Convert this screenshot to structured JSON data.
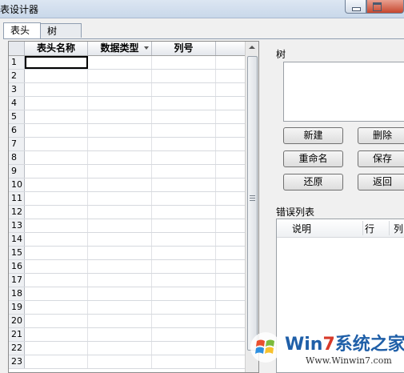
{
  "window": {
    "title": "表设计器"
  },
  "tabs": [
    {
      "label": "表头"
    },
    {
      "label": "树"
    }
  ],
  "grid": {
    "columns": [
      {
        "label": "表头名称"
      },
      {
        "label": "数据类型"
      },
      {
        "label": "列号"
      },
      {
        "label": ""
      }
    ],
    "rows": [
      "1",
      "2",
      "3",
      "4",
      "5",
      "6",
      "7",
      "8",
      "9",
      "10",
      "11",
      "12",
      "13",
      "14",
      "15",
      "16",
      "17",
      "18",
      "19",
      "20",
      "21",
      "22",
      "23"
    ]
  },
  "tree_panel": {
    "label": "树"
  },
  "buttons": {
    "new": "新建",
    "delete": "删除",
    "rename": "重命名",
    "save": "保存",
    "restore": "还原",
    "back": "返回"
  },
  "error_list": {
    "label": "错误列表",
    "columns": [
      {
        "label": "说明"
      },
      {
        "label": "行"
      },
      {
        "label": "列"
      }
    ]
  },
  "watermark": {
    "brand_prefix": "Win",
    "brand_seven": "7",
    "brand_suffix": "系统之家",
    "url": "Www.Winwin7.com"
  }
}
